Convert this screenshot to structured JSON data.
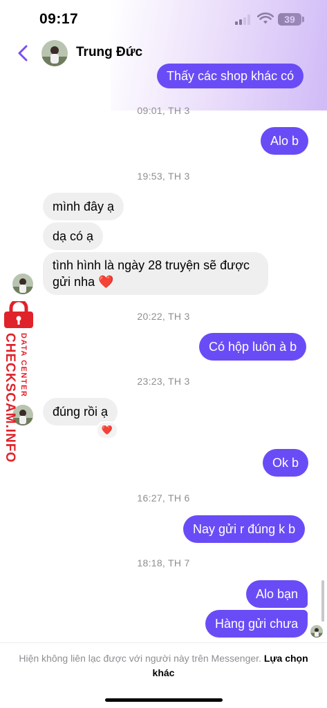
{
  "status_bar": {
    "time": "09:17",
    "battery": "39"
  },
  "header": {
    "contact_name": "Trung Đức"
  },
  "messages": {
    "m1": "Thấy các shop khác có",
    "t1": "09:01, TH 3",
    "m2": "Alo b",
    "t2": "19:53, TH 3",
    "m3": "mình đây ạ",
    "m4": "dạ có ạ",
    "m5_line1": "tình hình là ngày 28 truyện sẽ được",
    "m5_line2": "gửi nha",
    "t3": "20:22, TH 3",
    "m6": "Có hộp luôn à b",
    "t4": "23:23, TH 3",
    "m7": "đúng rồi ạ",
    "m8": "Ok b",
    "t5": "16:27, TH 6",
    "m9": "Nay gửi r đúng k b",
    "t6": "18:18, TH 7",
    "m10": "Alo bạn",
    "m11": "Hàng gửi chưa",
    "heart": "❤️"
  },
  "watermark": {
    "brand": "CHECKSCAM.INFO",
    "subtitle": "DATA CENTER"
  },
  "footer": {
    "notice": "Hiện không liên lạc được với người này trên Messenger.",
    "link": "Lựa chọn khác"
  },
  "colors": {
    "accent": "#6a4cf6",
    "incoming": "#efefef",
    "watermark": "#e0222a"
  }
}
